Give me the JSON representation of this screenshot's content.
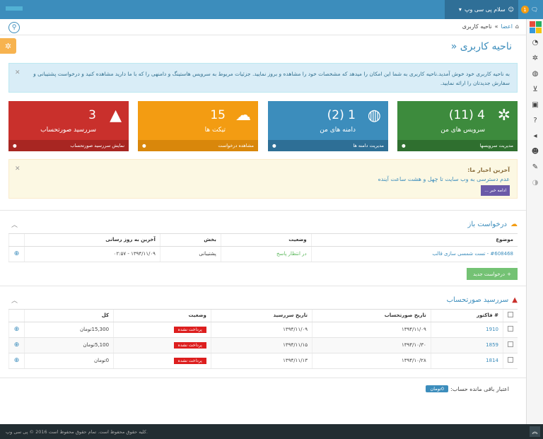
{
  "topbar": {
    "greeting": "سلام پی سی وپ",
    "notif_count": "1"
  },
  "breadcrumb": {
    "home": "اعضا",
    "sep": "»",
    "current": "ناحیه کاربری"
  },
  "page_title": "ناحیه کاربری «",
  "welcome_alert": "به ناحیه کاربری خود خوش آمدید.ناحیه کاربری به شما این امکان را میدهد که مشخصات خود را مشاهده و بروز نمایید. جزئیات مربوط به سرویس هاستینگ و دامنهی را که با ما دارید مشاهده کنید و درخواست پشتیبانی و سفارش جدیدتان را ارائه نمایید.",
  "stats": [
    {
      "num": "4 (11)",
      "label": "سرویس های من",
      "footer": "مدیریت سرویسها",
      "color": "#3d8b3d",
      "footcolor": "#2f6f2f",
      "icon": "gears-icon"
    },
    {
      "num": "1 (2)",
      "label": "دامنه های من",
      "footer": "مدیریت دامنه ها",
      "color": "#3c8dbc",
      "footcolor": "#2e6f96",
      "icon": "globe-icon"
    },
    {
      "num": "15",
      "label": "تیکت ها",
      "footer": "مشاهده درخواست",
      "color": "#f39c12",
      "footcolor": "#d9870b",
      "icon": "comments-icon"
    },
    {
      "num": "3",
      "label": "سررسید صورتحساب",
      "footer": "نمایش سررسید صورتحساب",
      "color": "#c9302c",
      "footcolor": "#a82622",
      "icon": "warning-icon"
    }
  ],
  "news": {
    "title": "آخرین اخبار ما:",
    "text": "عدم دسترسی به وب سایت تا چهل و هشت ساعت آینده",
    "more": "ادامه خبر ..."
  },
  "tickets": {
    "title": "درخواست باز",
    "headers": [
      "موضوع",
      "وضعیت",
      "بخش",
      "آخرین به روز رسانی"
    ],
    "rows": [
      {
        "subject": "#608468 - تست شمسی سازی قالب",
        "status": "در انتظار پاسخ",
        "dept": "پشتیبانی",
        "updated": "۱۳۹۴/۱۱/۰۹ - ۰۲:۵۷"
      }
    ],
    "new_button": "درخواست جدید"
  },
  "invoices": {
    "title": "سررسید صورتحساب",
    "headers": [
      "# فاکتور",
      "تاریخ صورتحساب",
      "تاریخ سررسید",
      "وضعیت",
      "کل"
    ],
    "rows": [
      {
        "id": "1910",
        "date": "۱۳۹۴/۱۱/۰۹",
        "due": "۱۳۹۴/۱۱/۰۹",
        "status": "پرداخت نشده",
        "total": "15,300تومان"
      },
      {
        "id": "1859",
        "date": "۱۳۹۴/۱۰/۳۰",
        "due": "۱۳۹۴/۱۱/۱۵",
        "status": "پرداخت نشده",
        "total": "5,100تومان"
      },
      {
        "id": "1814",
        "date": "۱۳۹۴/۱۰/۲۸",
        "due": "۱۳۹۴/۱۱/۱۳",
        "status": "پرداخت نشده",
        "total": "0تومان"
      }
    ]
  },
  "credit": {
    "label": "اعتبار باقی مانده حساب:",
    "value": "0تومان"
  },
  "footer": "کلیه حقوق محفوظ است. تمام حقوق محفوظ است 2016 © پی سی وپ.",
  "colors": {
    "primary": "#3c8dbc",
    "success": "#5cb85c",
    "danger": "#dd1e1e"
  }
}
